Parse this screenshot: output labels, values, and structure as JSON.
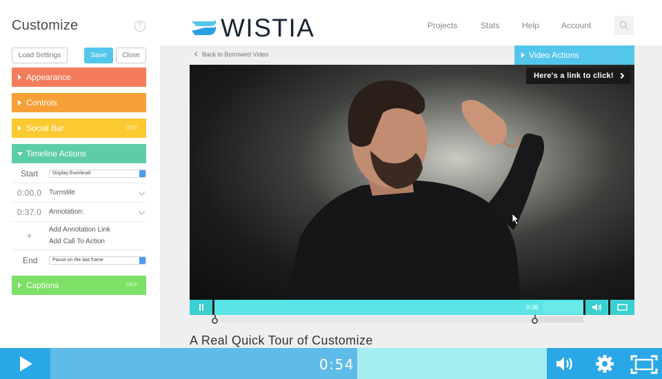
{
  "sidebar": {
    "title": "Customize",
    "help_glyph": "?",
    "buttons": {
      "load_settings": "Load Settings",
      "save": "Save",
      "close": "Close"
    },
    "panels": {
      "appearance": {
        "label": "Appearance",
        "color": "#f47c5c"
      },
      "controls": {
        "label": "Controls",
        "color": "#f7a037"
      },
      "social_bar": {
        "label": "Social Bar",
        "status": "OFF",
        "color": "#fbc930"
      },
      "timeline_actions": {
        "label": "Timeline Actions",
        "color": "#5dcca8"
      },
      "captions": {
        "label": "Captions",
        "status": "OFF",
        "color": "#7de165"
      }
    },
    "timeline": {
      "start_label": "Start",
      "start_select": "Display thumbnail",
      "rows": [
        {
          "time": "0:00.0",
          "action": "Turnstile"
        },
        {
          "time": "0:37.0",
          "action": "Annotation:"
        }
      ],
      "plus_glyph": "+",
      "add_annotation_link": "Add Annotation Link",
      "add_call_to_action": "Add Call To Action",
      "end_label": "End",
      "end_select": "Pause on the last frame"
    }
  },
  "header": {
    "logo_text": "WISTIA",
    "nav": [
      "Projects",
      "Stats",
      "Help",
      "Account"
    ]
  },
  "editor": {
    "back_link": "Back to Borrowed Video",
    "video_actions": "Video Actions",
    "annotation_text": "Here's a link to click!",
    "player_time": "0:38",
    "player_progress": 0.89,
    "video_title": "A Real Quick Tour of Customize"
  },
  "bottom_player": {
    "time": "0:54",
    "progress": 0.54,
    "colors": {
      "accent": "#2aa7e6",
      "played": "#5fbbe9",
      "unplayed": "#a4eef2"
    }
  }
}
